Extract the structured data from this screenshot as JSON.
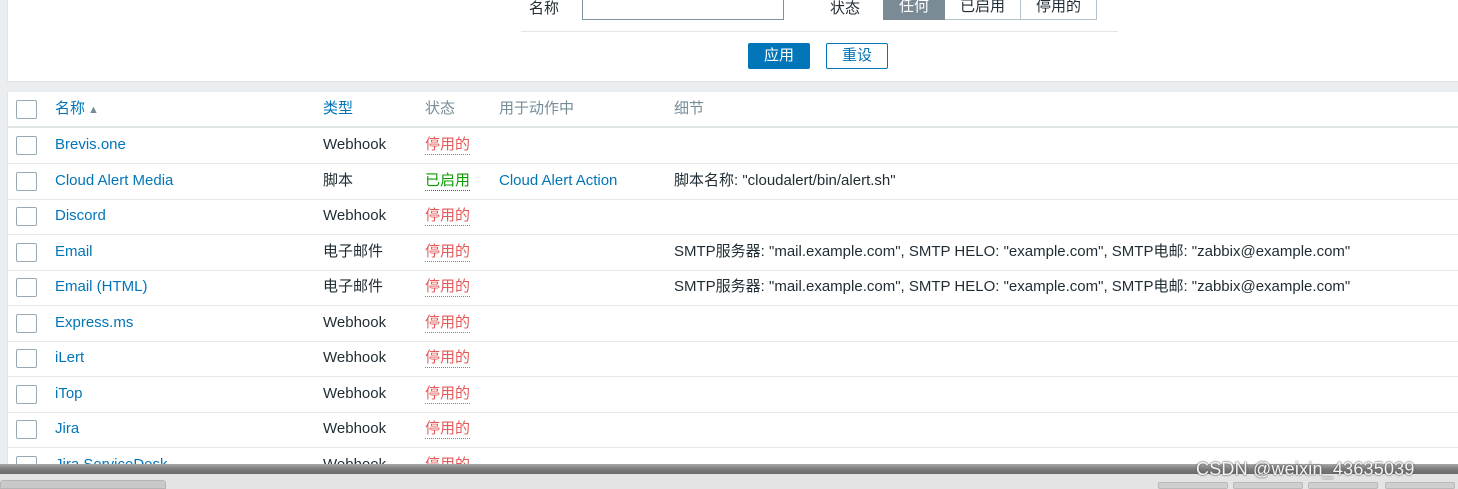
{
  "filter": {
    "name_label": "名称",
    "name_value": "",
    "status_label": "状态",
    "status_options": [
      "任何",
      "已启用",
      "停用的"
    ],
    "status_selected": "任何",
    "apply_label": "应用",
    "reset_label": "重设"
  },
  "table": {
    "columns": {
      "name": "名称",
      "sort_arrow": "▲",
      "type": "类型",
      "status": "状态",
      "used_in_actions": "用于动作中",
      "details": "细节"
    },
    "rows": [
      {
        "name": "Brevis.one",
        "type": "Webhook",
        "status": "停用的",
        "action": "",
        "details": ""
      },
      {
        "name": "Cloud Alert Media",
        "type": "脚本",
        "status": "已启用",
        "action": "Cloud Alert Action",
        "details": "脚本名称: \"cloudalert/bin/alert.sh\""
      },
      {
        "name": "Discord",
        "type": "Webhook",
        "status": "停用的",
        "action": "",
        "details": ""
      },
      {
        "name": "Email",
        "type": "电子邮件",
        "status": "停用的",
        "action": "",
        "details": "SMTP服务器: \"mail.example.com\", SMTP HELO: \"example.com\", SMTP电邮: \"zabbix@example.com\""
      },
      {
        "name": "Email (HTML)",
        "type": "电子邮件",
        "status": "停用的",
        "action": "",
        "details": "SMTP服务器: \"mail.example.com\", SMTP HELO: \"example.com\", SMTP电邮: \"zabbix@example.com\""
      },
      {
        "name": "Express.ms",
        "type": "Webhook",
        "status": "停用的",
        "action": "",
        "details": ""
      },
      {
        "name": "iLert",
        "type": "Webhook",
        "status": "停用的",
        "action": "",
        "details": ""
      },
      {
        "name": "iTop",
        "type": "Webhook",
        "status": "停用的",
        "action": "",
        "details": ""
      },
      {
        "name": "Jira",
        "type": "Webhook",
        "status": "停用的",
        "action": "",
        "details": ""
      },
      {
        "name": "Jira ServiceDesk",
        "type": "Webhook",
        "status": "停用的",
        "action": "",
        "details": ""
      }
    ]
  },
  "colors": {
    "link": "#0275b8",
    "disabled": "#e45959",
    "enabled": "#0c9b00"
  },
  "watermark": "CSDN @weixin_43635039"
}
